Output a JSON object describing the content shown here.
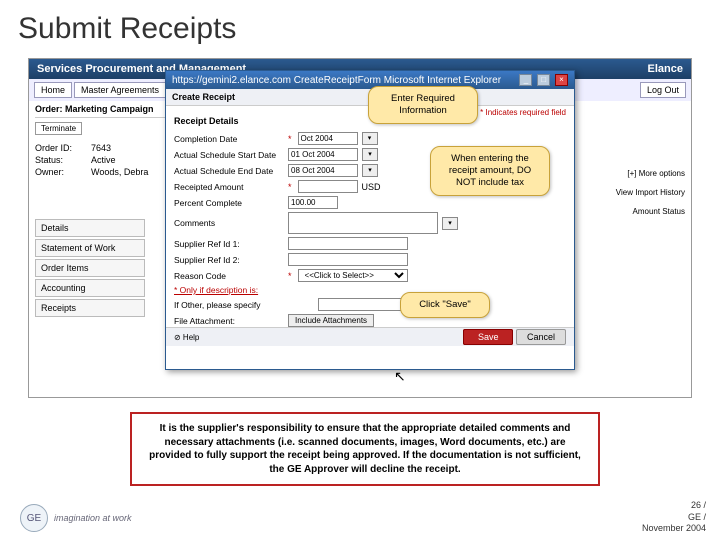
{
  "slide": {
    "title": "Submit Receipts"
  },
  "app": {
    "header_left": "Services Procurement and Management",
    "header_right": "Elance",
    "nav": {
      "home": "Home",
      "master": "Master Agreements"
    },
    "nav_right": {
      "logout": "Log Out"
    },
    "order": {
      "heading": "Order: Marketing Campaign",
      "terminate": "Terminate",
      "id_k": "Order ID:",
      "id_v": "7643",
      "status_k": "Status:",
      "status_v": "Active",
      "owner_k": "Owner:",
      "owner_v": "Woods, Debra"
    },
    "side": {
      "details": "Details",
      "sow": "Statement of Work",
      "items": "Order Items",
      "acct": "Accounting",
      "rec": "Receipts"
    },
    "right": {
      "more": "[+] More options",
      "hist": "View Import History",
      "amt": "Amount Status"
    }
  },
  "modal": {
    "titlebar": "https://gemini2.elance.com  CreateReceiptForm  Microsoft Internet Explorer",
    "subtitle": "Create Receipt",
    "req": "* Indicates required field",
    "section": "Receipt Details",
    "rows": {
      "comp": "Completion Date",
      "comp_val": "Oct 2004",
      "start": "Actual Schedule Start Date",
      "start_val": "01 Oct 2004",
      "end": "Actual Schedule End Date",
      "end_val": "08 Oct 2004",
      "amt": "Receipted Amount",
      "amt_val": "",
      "amt_unit": "USD",
      "pct": "Percent Complete",
      "pct_val": "100.00",
      "comm": "Comments",
      "ref1": "Supplier Ref Id 1:",
      "ref2": "Supplier Ref Id 2:",
      "reason": "Reason Code",
      "reason_val": "<<Click to Select>>",
      "descr": "* Only if description is:",
      "other": "If Other, please specify",
      "attach": "File Attachment:",
      "attach_btn": "Include Attachments"
    },
    "foot": {
      "help": "⊘ Help",
      "save": "Save",
      "cancel": "Cancel"
    }
  },
  "callouts": {
    "c1": "Enter Required Information",
    "c2": "When entering the receipt amount, DO NOT include tax",
    "c3": "Click \"Save\""
  },
  "redbox": "It is the supplier's responsibility to ensure that the appropriate detailed comments and necessary attachments (i.e. scanned documents, images, Word documents, etc.) are provided to fully support the receipt being approved. If the documentation is not sufficient, the GE Approver will decline the receipt.",
  "footer": {
    "logo": "GE",
    "tagline": "imagination at work",
    "page": "26 /",
    "org": "GE /",
    "date": "November 2004"
  }
}
